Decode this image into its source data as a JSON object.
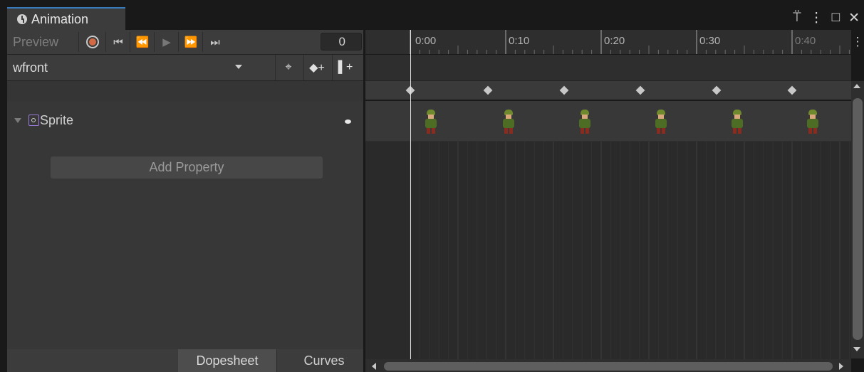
{
  "window": {
    "tab_title": "Animation",
    "controls": {
      "lock": "⍡",
      "menu": "⋮",
      "maximize": "□",
      "close": "✕"
    }
  },
  "toolbar": {
    "preview_label": "Preview",
    "frame_value": "0",
    "buttons": {
      "first": "⏮",
      "prev": "⏪",
      "play": "▶",
      "next": "⏩",
      "last": "⏭"
    }
  },
  "clip": {
    "name": "wfront",
    "filter_icon": "⌖",
    "add_key_icon": "◆+",
    "add_event_icon": "▌+"
  },
  "properties": {
    "items": [
      {
        "label": "Sprite"
      }
    ],
    "add_property_label": "Add Property"
  },
  "bottom_tabs": {
    "dopesheet": "Dopesheet",
    "curves": "Curves"
  },
  "timeline": {
    "ticks": [
      "0:00",
      "0:10",
      "0:20",
      "0:30",
      "0:40"
    ],
    "keyframe_count": 6
  },
  "colors": {
    "accent": "#3a79bb",
    "record": "#d46a43",
    "bg_panel": "#3c3c3c",
    "bg_track": "#2a2a2a"
  }
}
